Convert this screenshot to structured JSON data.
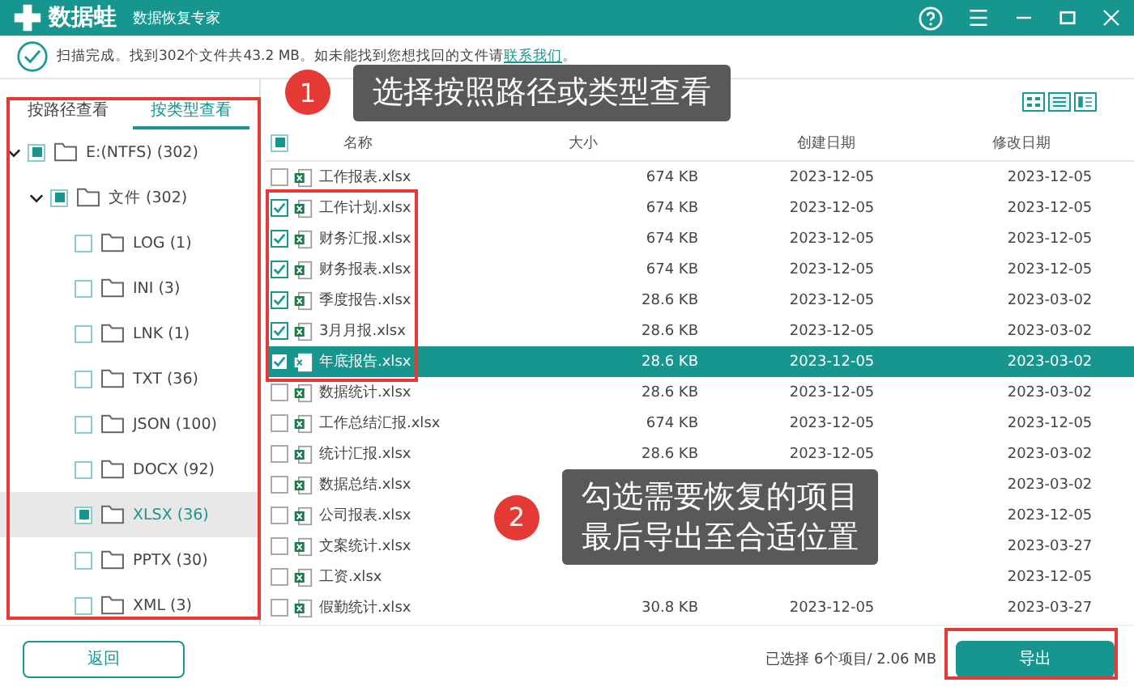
{
  "app": {
    "logo_text": "数据蛙",
    "subtitle": "数据恢复专家"
  },
  "status": {
    "message": "扫描完成。找到302个文件共43.2 MB。如未能找到您想找回的文件请",
    "link": "联系我们",
    "end": "。"
  },
  "tabs": [
    {
      "label": "按路径查看",
      "selected": false
    },
    {
      "label": "按类型查看",
      "selected": true
    }
  ],
  "tree": [
    {
      "label": "E:(NTFS) (302)",
      "checked": true,
      "expanded": true,
      "selected": false,
      "children": [
        {
          "label": "文件 (302)",
          "checked": true,
          "expanded": true,
          "selected": false,
          "children": [
            {
              "label": "LOG (1)",
              "checked": false,
              "selected": false
            },
            {
              "label": "INI (3)",
              "checked": false,
              "selected": false
            },
            {
              "label": "LNK (1)",
              "checked": false,
              "selected": false
            },
            {
              "label": "TXT (36)",
              "checked": false,
              "selected": false
            },
            {
              "label": "JSON (100)",
              "checked": false,
              "selected": false
            },
            {
              "label": "DOCX (92)",
              "checked": false,
              "selected": false
            },
            {
              "label": "XLSX (36)",
              "checked": true,
              "selected": true
            },
            {
              "label": "PPTX (30)",
              "checked": false,
              "selected": false
            },
            {
              "label": "XML (3)",
              "checked": false,
              "selected": false
            }
          ]
        }
      ]
    }
  ],
  "table": {
    "header_checked": true,
    "columns": [
      "名称",
      "大小",
      "创建日期",
      "修改日期"
    ],
    "rows": [
      {
        "name": "工作报表.xlsx",
        "size": "674 KB",
        "created": "2023-12-05",
        "modified": "2023-12-05",
        "checked": false,
        "selected": false
      },
      {
        "name": "工作计划.xlsx",
        "size": "674 KB",
        "created": "2023-12-05",
        "modified": "2023-12-05",
        "checked": true,
        "selected": false
      },
      {
        "name": "财务汇报.xlsx",
        "size": "674 KB",
        "created": "2023-12-05",
        "modified": "2023-12-05",
        "checked": true,
        "selected": false
      },
      {
        "name": "财务报表.xlsx",
        "size": "674 KB",
        "created": "2023-12-05",
        "modified": "2023-12-05",
        "checked": true,
        "selected": false
      },
      {
        "name": "季度报告.xlsx",
        "size": "28.6 KB",
        "created": "2023-12-05",
        "modified": "2023-03-02",
        "checked": true,
        "selected": false
      },
      {
        "name": "3月月报.xlsx",
        "size": "28.6 KB",
        "created": "2023-12-05",
        "modified": "2023-03-02",
        "checked": true,
        "selected": false
      },
      {
        "name": "年底报告.xlsx",
        "size": "28.6 KB",
        "created": "2023-12-05",
        "modified": "2023-03-02",
        "checked": true,
        "selected": true
      },
      {
        "name": "数据统计.xlsx",
        "size": "28.6 KB",
        "created": "2023-12-05",
        "modified": "2023-03-02",
        "checked": false,
        "selected": false
      },
      {
        "name": "工作总结汇报.xlsx",
        "size": "674 KB",
        "created": "2023-12-05",
        "modified": "2023-12-05",
        "checked": false,
        "selected": false
      },
      {
        "name": "统计汇报.xlsx",
        "size": "28.6 KB",
        "created": "2023-12-05",
        "modified": "2023-03-02",
        "checked": false,
        "selected": false
      },
      {
        "name": "数据总结.xlsx",
        "modified": "2023-03-02",
        "checked": false,
        "selected": false
      },
      {
        "name": "公司报表.xlsx",
        "modified": "2023-12-05",
        "checked": false,
        "selected": false
      },
      {
        "name": "文案统计.xlsx",
        "modified": "2023-03-27",
        "checked": false,
        "selected": false
      },
      {
        "name": "工资.xlsx",
        "modified": "2023-12-05",
        "checked": false,
        "selected": false
      },
      {
        "name": "假勤统计.xlsx",
        "size": "30.8 KB",
        "created": "2023-12-05",
        "modified": "2023-03-27",
        "checked": false,
        "selected": false
      }
    ]
  },
  "callouts": [
    {
      "number": "1",
      "lines": [
        "选择按照路径或类型查看"
      ]
    },
    {
      "number": "2",
      "lines": [
        "勾选需要恢复的项目",
        "最后导出至合适位置"
      ]
    }
  ],
  "footer": {
    "back": "返回",
    "summary": "已选择 6个项目/ 2.06 MB",
    "export": "导出"
  }
}
